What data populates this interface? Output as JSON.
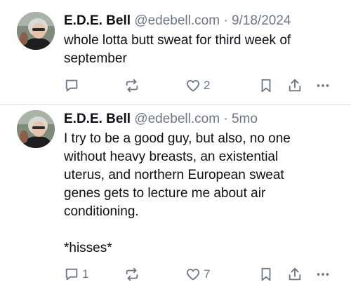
{
  "posts": [
    {
      "author_name": "E.D.E. Bell",
      "handle": "@edebell.com",
      "separator": "·",
      "timestamp": "9/18/2024",
      "text": "whole lotta butt sweat for third week of september",
      "replies": "",
      "reposts": "",
      "likes": "2"
    },
    {
      "author_name": "E.D.E. Bell",
      "handle": "@edebell.com",
      "separator": "·",
      "timestamp": "5mo",
      "text": "I try to be a good guy, but also, no one\nwithout heavy breasts, an existential\nuterus, and northern European sweat\ngenes gets to lecture me about air\nconditioning.\n\n*hisses*",
      "replies": "1",
      "reposts": "",
      "likes": "7"
    }
  ],
  "icons": {
    "reply": "speech-bubble-icon",
    "repost": "repost-arrows-icon",
    "like": "heart-outline-icon",
    "bookmark": "bookmark-icon",
    "share": "share-upload-icon",
    "more": "more-dots-icon"
  },
  "colors": {
    "text": "#0b0f14",
    "muted": "#6b7785",
    "divider": "#dfe3e8"
  }
}
